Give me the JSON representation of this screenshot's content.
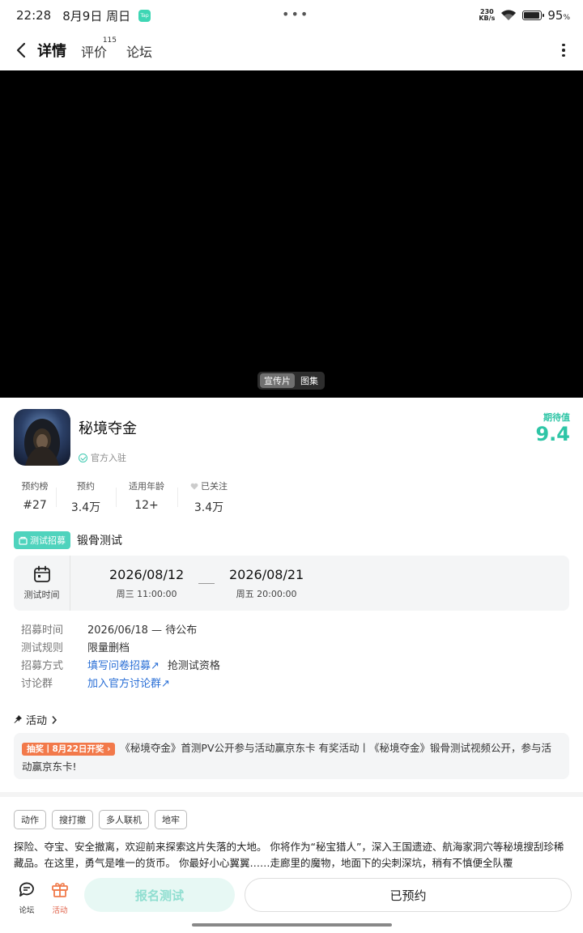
{
  "status_bar": {
    "time": "22:28",
    "date": "8月9日 周日",
    "app_badge": "Tap",
    "net_speed_value": "230",
    "net_speed_unit": "KB/s",
    "battery_pct": "95",
    "battery_unit": "%",
    "battery_level": 0.95
  },
  "nav": {
    "tabs": [
      {
        "label": "详情",
        "active": true
      },
      {
        "label": "评价",
        "badge": "115"
      },
      {
        "label": "论坛"
      }
    ]
  },
  "media": {
    "options": [
      "宣传片",
      "图集"
    ]
  },
  "game": {
    "name": "秘境夺金",
    "official_label": "官方入驻",
    "rating_label": "期待值",
    "rating_value": "9.4"
  },
  "stats": [
    {
      "label": "预约榜",
      "value": "#27"
    },
    {
      "label": "预约",
      "value": "3.4万"
    },
    {
      "label": "适用年龄",
      "value": "12+"
    },
    {
      "label": "已关注",
      "value": "3.4万"
    }
  ],
  "test": {
    "tag": "测试招募",
    "name": "锻骨测试",
    "time_label": "测试时间",
    "start_date": "2026/08/12",
    "start_time": "周三  11:00:00",
    "end_date": "2026/08/21",
    "end_time": "周五  20:00:00"
  },
  "info": [
    {
      "key": "招募时间",
      "value": "2026/06/18 — 待公布"
    },
    {
      "key": "测试规则",
      "value": "限量删档"
    },
    {
      "key": "招募方式",
      "link": "填写问卷招募↗",
      "value": "抢测试资格"
    },
    {
      "key": "讨论群",
      "link": "加入官方讨论群↗"
    }
  ],
  "activity": {
    "title": "活动",
    "promo": "抽奖丨8月22日开奖",
    "text": "《秘境夺金》首测PV公开参与活动赢京东卡 有奖活动丨《秘境夺金》锻骨测试视频公开，参与活动赢京东卡!"
  },
  "tags": [
    "动作",
    "搜打撤",
    "多人联机",
    "地牢"
  ],
  "description": "探险、夺宝、安全撤离，欢迎前来探索这片失落的大地。 你将作为“秘宝猎人”，深入王国遗迹、航海家洞穴等秘境搜刮珍稀藏品。在这里，勇气是唯一的货币。 你最好小心翼翼……走廊里的魔物，地面下的尖刺深坑，稍有不慎便全队覆",
  "bottom": {
    "forum_label": "论坛",
    "activity_label": "活动",
    "signup_label": "报名测试",
    "reserved_label": "已预约"
  },
  "colors": {
    "accent": "#2ec5a6",
    "promo": "#f2794a",
    "link": "#2a6fd6"
  }
}
